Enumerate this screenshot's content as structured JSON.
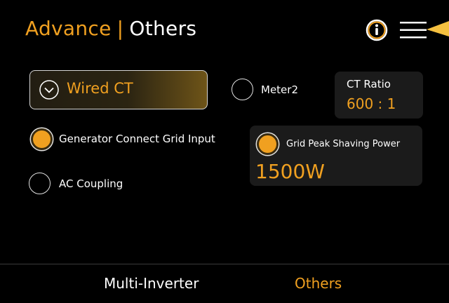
{
  "header": {
    "title_primary": "Advance",
    "separator": "|",
    "title_secondary": "Others",
    "info_icon": "info-icon",
    "menu_icon": "hamburger-menu-icon"
  },
  "ct_source": {
    "selected_label": "Wired CT",
    "icon": "chevron-down-circle-icon"
  },
  "options": {
    "meter2": {
      "label": "Meter2",
      "selected": false
    },
    "generator_connect_grid_input": {
      "label": "Generator Connect Grid Input",
      "selected": true
    },
    "ac_coupling": {
      "label": "AC Coupling",
      "selected": false
    },
    "grid_peak_shaving": {
      "label": "Grid Peak Shaving Power",
      "selected": true,
      "value": "1500W"
    }
  },
  "ct_ratio": {
    "label": "CT Ratio",
    "value": "600 : 1"
  },
  "bottom_tabs": [
    {
      "label": "Multi-Inverter",
      "active": false
    },
    {
      "label": "Others",
      "active": true
    }
  ],
  "colors": {
    "accent": "#f0a020",
    "background": "#000000",
    "card": "#1b1b1b"
  }
}
